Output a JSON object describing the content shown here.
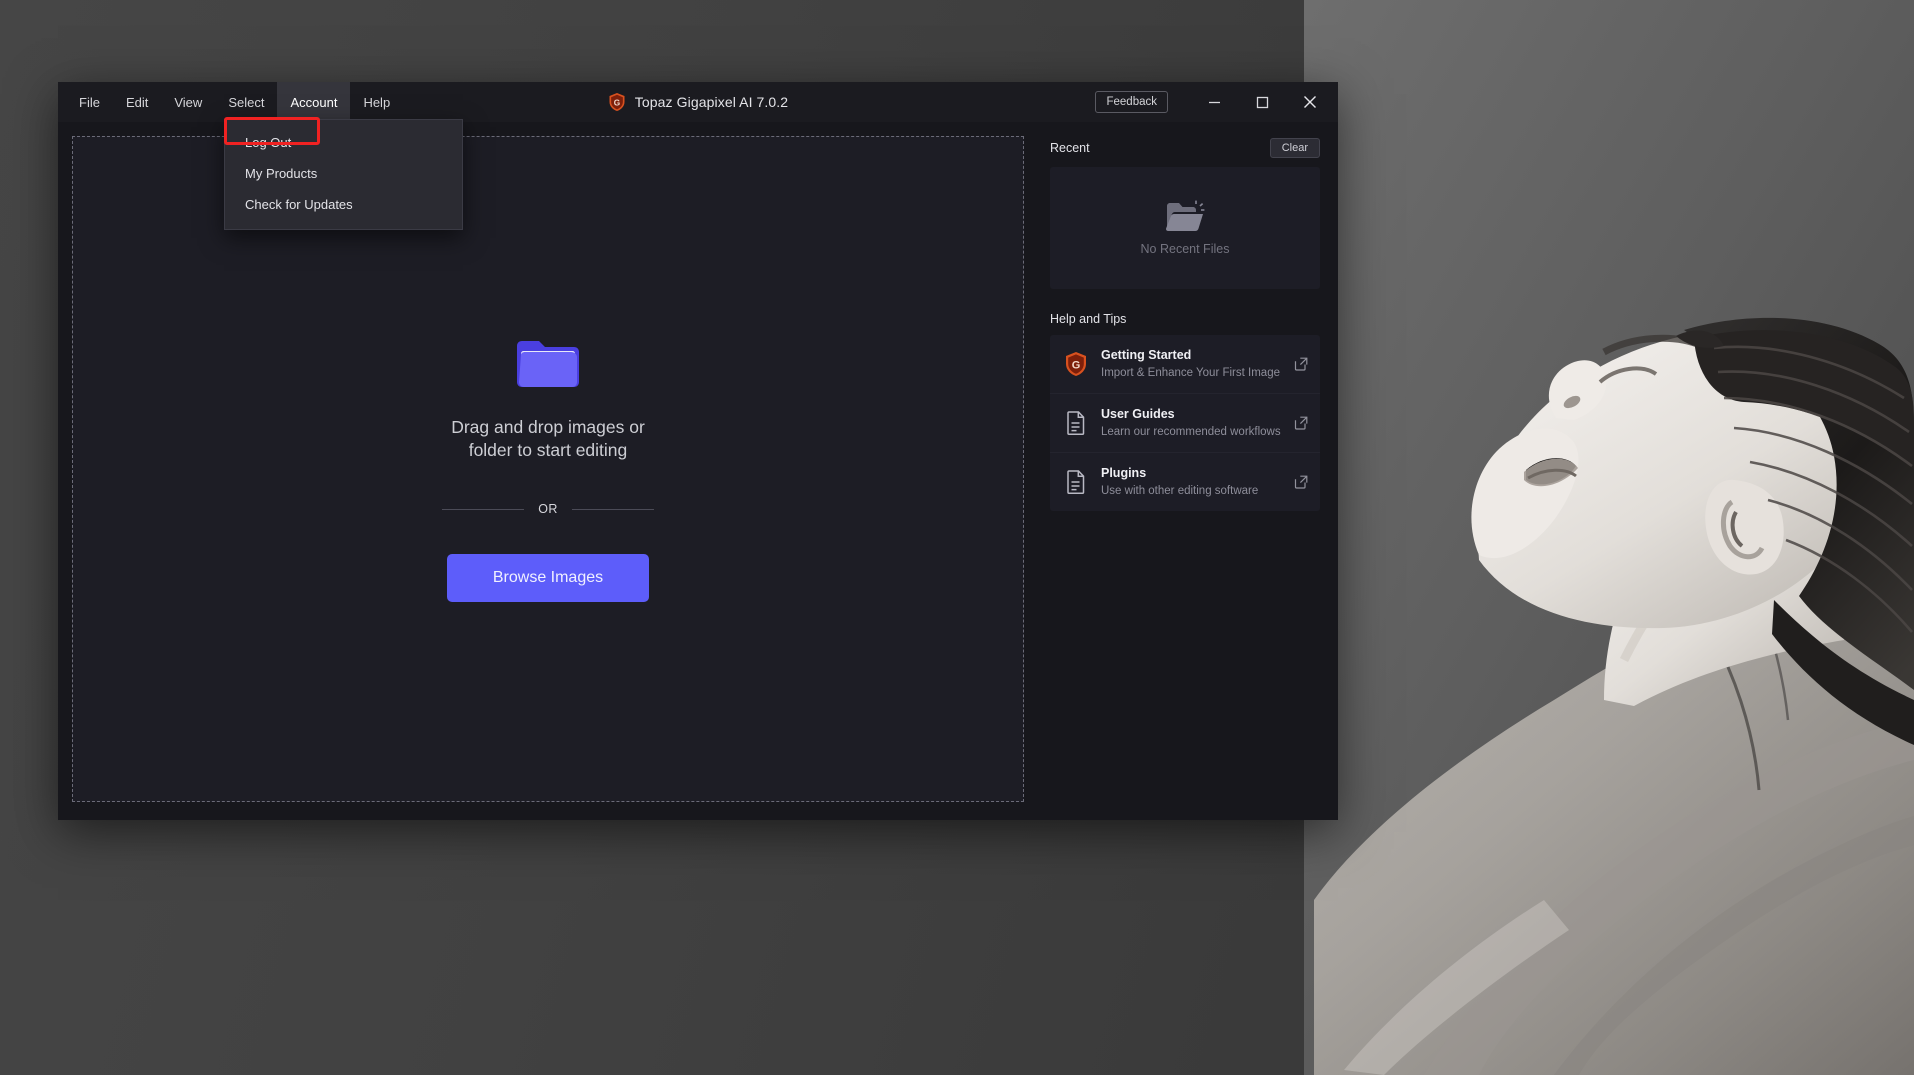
{
  "window": {
    "title": "Topaz Gigapixel AI 7.0.2",
    "brand_icon": "topaz-shield-logo",
    "feedback_label": "Feedback",
    "minimize_icon": "minimize-icon",
    "maximize_icon": "maximize-icon",
    "close_icon": "close-icon"
  },
  "menubar": {
    "items": [
      {
        "label": "File",
        "active": false
      },
      {
        "label": "Edit",
        "active": false
      },
      {
        "label": "View",
        "active": false
      },
      {
        "label": "Select",
        "active": false
      },
      {
        "label": "Account",
        "active": true
      },
      {
        "label": "Help",
        "active": false
      }
    ]
  },
  "account_menu": {
    "open": true,
    "highlighted_item": "Log Out",
    "items": [
      {
        "label": "Log Out"
      },
      {
        "label": "My Products"
      },
      {
        "label": "Check for Updates"
      }
    ]
  },
  "dropzone": {
    "folder_icon": "folder-icon",
    "message_line1": "Drag and drop images or",
    "message_line2": "folder to start editing",
    "divider_label": "OR",
    "browse_label": "Browse Images"
  },
  "recent": {
    "title": "Recent",
    "clear_label": "Clear",
    "empty_icon": "open-folder-icon",
    "empty_label": "No Recent Files"
  },
  "help_and_tips": {
    "title": "Help and Tips",
    "items": [
      {
        "icon": "topaz-shield-logo",
        "name": "Getting Started",
        "subtitle": "Import & Enhance Your First Image",
        "link_icon": "external-link-icon"
      },
      {
        "icon": "document-icon",
        "name": "User Guides",
        "subtitle": "Learn our recommended workflows",
        "link_icon": "external-link-icon"
      },
      {
        "icon": "document-icon",
        "name": "Plugins",
        "subtitle": "Use with other editing software",
        "link_icon": "external-link-icon"
      }
    ]
  },
  "colors": {
    "accent_blue": "#5d5dfa",
    "brand_orange": "#d8511f",
    "highlight_red": "#f02222",
    "window_bg": "#17171c",
    "panel_bg": "#1d1d26",
    "desktop_bg": "#3e3e3e"
  },
  "desktop": {
    "wallpaper": "black-and-white-portrait-photo"
  }
}
